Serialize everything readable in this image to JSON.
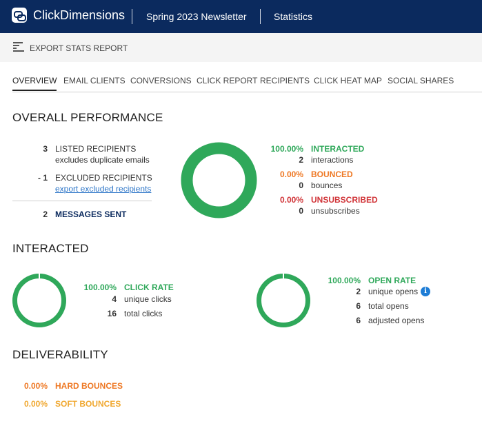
{
  "header": {
    "app_name": "ClickDimensions",
    "breadcrumb_1": "Spring 2023 Newsletter",
    "breadcrumb_2": "Statistics"
  },
  "command_bar": {
    "export_label": "EXPORT STATS REPORT",
    "export_icon": "report-icon"
  },
  "tabs": [
    "OVERVIEW",
    "EMAIL CLIENTS",
    "CONVERSIONS",
    "CLICK REPORT",
    "RECIPIENTS",
    "CLICK HEAT MAP",
    "SOCIAL SHARES"
  ],
  "overall": {
    "title": "OVERALL PERFORMANCE",
    "listed_count": "3",
    "listed_label": "LISTED RECIPIENTS",
    "listed_sub": "excludes duplicate emails",
    "excluded_count": "- 1",
    "excluded_label": "EXCLUDED RECIPIENTS",
    "excluded_link": "export excluded recipients",
    "sent_count": "2",
    "sent_label": "MESSAGES SENT",
    "interacted_pct": "100.00%",
    "interacted_label": "INTERACTED",
    "interactions_count": "2",
    "interactions_label": "interactions",
    "bounced_pct": "0.00%",
    "bounced_label": "BOUNCED",
    "bounces_count": "0",
    "bounces_label": "bounces",
    "unsub_pct": "0.00%",
    "unsub_label": "UNSUBSCRIBED",
    "unsubscribes_count": "0",
    "unsubscribes_label": "unsubscribes",
    "ring_fraction": 1.0
  },
  "interacted": {
    "title": "INTERACTED",
    "click_pct": "100.00%",
    "click_label": "CLICK RATE",
    "unique_clicks_count": "4",
    "unique_clicks_label": "unique clicks",
    "total_clicks_count": "16",
    "total_clicks_label": "total clicks",
    "click_ring_fraction": 1.0,
    "open_pct": "100.00%",
    "open_label": "OPEN RATE",
    "unique_opens_count": "2",
    "unique_opens_label": "unique opens",
    "total_opens_count": "6",
    "total_opens_label": "total opens",
    "adjusted_opens_count": "6",
    "adjusted_opens_label": "adjusted opens",
    "open_ring_fraction": 1.0
  },
  "deliverability": {
    "title": "DELIVERABILITY",
    "hard_pct": "0.00%",
    "hard_label": "HARD BOUNCES",
    "soft_pct": "0.00%",
    "soft_label": "SOFT BOUNCES"
  },
  "colors": {
    "header_bg": "#0b2a5e",
    "ring_green": "#2fa85a",
    "orange": "#ee7722",
    "red": "#d13438",
    "yellow": "#f0a830",
    "link": "#2b74c7"
  }
}
